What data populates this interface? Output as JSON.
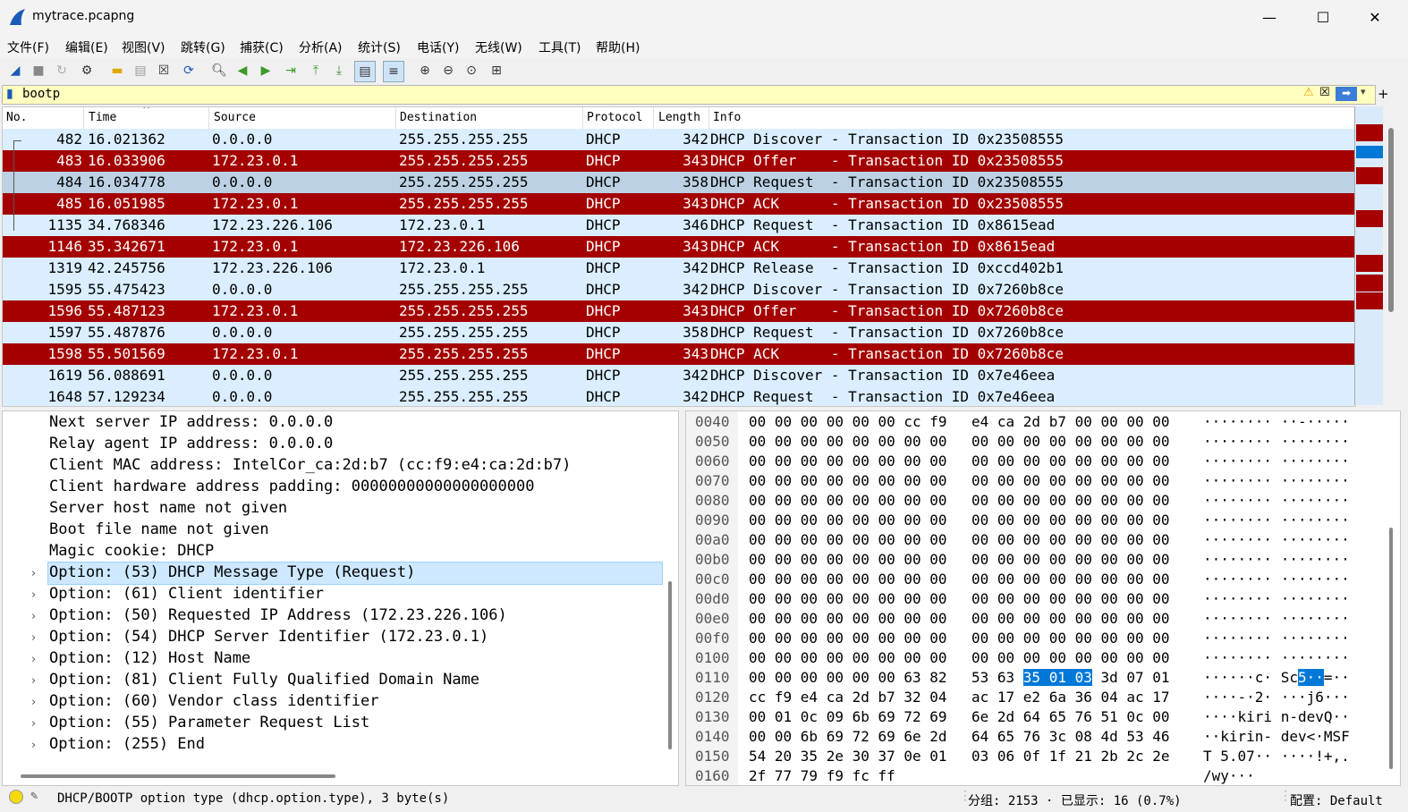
{
  "window": {
    "title": "mytrace.pcapng"
  },
  "menu": [
    "文件(F)",
    "编辑(E)",
    "视图(V)",
    "跳转(G)",
    "捕获(C)",
    "分析(A)",
    "统计(S)",
    "电话(Y)",
    "无线(W)",
    "工具(T)",
    "帮助(H)"
  ],
  "filter": {
    "value": "bootp"
  },
  "columns": [
    "No.",
    "Time",
    "Source",
    "Destination",
    "Protocol",
    "Length",
    "Info"
  ],
  "packets": [
    {
      "no": "482",
      "time": "16.021362",
      "src": "0.0.0.0",
      "dst": "255.255.255.255",
      "proto": "DHCP",
      "len": "342",
      "info": "DHCP Discover - Transaction ID 0x23508555",
      "style": "light"
    },
    {
      "no": "483",
      "time": "16.033906",
      "src": "172.23.0.1",
      "dst": "255.255.255.255",
      "proto": "DHCP",
      "len": "343",
      "info": "DHCP Offer    - Transaction ID 0x23508555",
      "style": "dark"
    },
    {
      "no": "484",
      "time": "16.034778",
      "src": "0.0.0.0",
      "dst": "255.255.255.255",
      "proto": "DHCP",
      "len": "358",
      "info": "DHCP Request  - Transaction ID 0x23508555",
      "style": "sel"
    },
    {
      "no": "485",
      "time": "16.051985",
      "src": "172.23.0.1",
      "dst": "255.255.255.255",
      "proto": "DHCP",
      "len": "343",
      "info": "DHCP ACK      - Transaction ID 0x23508555",
      "style": "dark"
    },
    {
      "no": "1135",
      "time": "34.768346",
      "src": "172.23.226.106",
      "dst": "172.23.0.1",
      "proto": "DHCP",
      "len": "346",
      "info": "DHCP Request  - Transaction ID 0x8615ead",
      "style": "light"
    },
    {
      "no": "1146",
      "time": "35.342671",
      "src": "172.23.0.1",
      "dst": "172.23.226.106",
      "proto": "DHCP",
      "len": "343",
      "info": "DHCP ACK      - Transaction ID 0x8615ead",
      "style": "dark"
    },
    {
      "no": "1319",
      "time": "42.245756",
      "src": "172.23.226.106",
      "dst": "172.23.0.1",
      "proto": "DHCP",
      "len": "342",
      "info": "DHCP Release  - Transaction ID 0xccd402b1",
      "style": "light"
    },
    {
      "no": "1595",
      "time": "55.475423",
      "src": "0.0.0.0",
      "dst": "255.255.255.255",
      "proto": "DHCP",
      "len": "342",
      "info": "DHCP Discover - Transaction ID 0x7260b8ce",
      "style": "light"
    },
    {
      "no": "1596",
      "time": "55.487123",
      "src": "172.23.0.1",
      "dst": "255.255.255.255",
      "proto": "DHCP",
      "len": "343",
      "info": "DHCP Offer    - Transaction ID 0x7260b8ce",
      "style": "dark"
    },
    {
      "no": "1597",
      "time": "55.487876",
      "src": "0.0.0.0",
      "dst": "255.255.255.255",
      "proto": "DHCP",
      "len": "358",
      "info": "DHCP Request  - Transaction ID 0x7260b8ce",
      "style": "light"
    },
    {
      "no": "1598",
      "time": "55.501569",
      "src": "172.23.0.1",
      "dst": "255.255.255.255",
      "proto": "DHCP",
      "len": "343",
      "info": "DHCP ACK      - Transaction ID 0x7260b8ce",
      "style": "dark"
    },
    {
      "no": "1619",
      "time": "56.088691",
      "src": "0.0.0.0",
      "dst": "255.255.255.255",
      "proto": "DHCP",
      "len": "342",
      "info": "DHCP Discover - Transaction ID 0x7e46eea",
      "style": "light"
    },
    {
      "no": "1648",
      "time": "57.129234",
      "src": "0.0.0.0",
      "dst": "255.255.255.255",
      "proto": "DHCP",
      "len": "342",
      "info": "DHCP Request  - Transaction ID 0x7e46eea",
      "style": "light"
    }
  ],
  "details": [
    {
      "text": "Next server IP address: 0.0.0.0",
      "expandable": false
    },
    {
      "text": "Relay agent IP address: 0.0.0.0",
      "expandable": false
    },
    {
      "text": "Client MAC address: IntelCor_ca:2d:b7 (cc:f9:e4:ca:2d:b7)",
      "expandable": false
    },
    {
      "text": "Client hardware address padding: 00000000000000000000",
      "expandable": false
    },
    {
      "text": "Server host name not given",
      "expandable": false
    },
    {
      "text": "Boot file name not given",
      "expandable": false
    },
    {
      "text": "Magic cookie: DHCP",
      "expandable": false
    },
    {
      "text": "Option: (53) DHCP Message Type (Request)",
      "expandable": true
    },
    {
      "text": "Option: (61) Client identifier",
      "expandable": true
    },
    {
      "text": "Option: (50) Requested IP Address (172.23.226.106)",
      "expandable": true
    },
    {
      "text": "Option: (54) DHCP Server Identifier (172.23.0.1)",
      "expandable": true
    },
    {
      "text": "Option: (12) Host Name",
      "expandable": true
    },
    {
      "text": "Option: (81) Client Fully Qualified Domain Name",
      "expandable": true
    },
    {
      "text": "Option: (60) Vendor class identifier",
      "expandable": true
    },
    {
      "text": "Option: (55) Parameter Request List",
      "expandable": true
    },
    {
      "text": "Option: (255) End",
      "expandable": true
    }
  ],
  "hex": [
    {
      "off": "0040",
      "a": "00 00 00 00 00 00 cc f9",
      "b": "e4 ca 2d b7 00 00 00 00",
      "ascii": "········ ··-·····"
    },
    {
      "off": "0050",
      "a": "00 00 00 00 00 00 00 00",
      "b": "00 00 00 00 00 00 00 00",
      "ascii": "········ ········"
    },
    {
      "off": "0060",
      "a": "00 00 00 00 00 00 00 00",
      "b": "00 00 00 00 00 00 00 00",
      "ascii": "········ ········"
    },
    {
      "off": "0070",
      "a": "00 00 00 00 00 00 00 00",
      "b": "00 00 00 00 00 00 00 00",
      "ascii": "········ ········"
    },
    {
      "off": "0080",
      "a": "00 00 00 00 00 00 00 00",
      "b": "00 00 00 00 00 00 00 00",
      "ascii": "········ ········"
    },
    {
      "off": "0090",
      "a": "00 00 00 00 00 00 00 00",
      "b": "00 00 00 00 00 00 00 00",
      "ascii": "········ ········"
    },
    {
      "off": "00a0",
      "a": "00 00 00 00 00 00 00 00",
      "b": "00 00 00 00 00 00 00 00",
      "ascii": "········ ········"
    },
    {
      "off": "00b0",
      "a": "00 00 00 00 00 00 00 00",
      "b": "00 00 00 00 00 00 00 00",
      "ascii": "········ ········"
    },
    {
      "off": "00c0",
      "a": "00 00 00 00 00 00 00 00",
      "b": "00 00 00 00 00 00 00 00",
      "ascii": "········ ········"
    },
    {
      "off": "00d0",
      "a": "00 00 00 00 00 00 00 00",
      "b": "00 00 00 00 00 00 00 00",
      "ascii": "········ ········"
    },
    {
      "off": "00e0",
      "a": "00 00 00 00 00 00 00 00",
      "b": "00 00 00 00 00 00 00 00",
      "ascii": "········ ········"
    },
    {
      "off": "00f0",
      "a": "00 00 00 00 00 00 00 00",
      "b": "00 00 00 00 00 00 00 00",
      "ascii": "········ ········"
    },
    {
      "off": "0100",
      "a": "00 00 00 00 00 00 00 00",
      "b": "00 00 00 00 00 00 00 00",
      "ascii": "········ ········"
    },
    {
      "off": "0110",
      "a": "00 00 00 00 00 00 63 82",
      "b": "53 63 35 01 03 3d 07 01",
      "ascii": "······c· Sc5··=··"
    },
    {
      "off": "0120",
      "a": "cc f9 e4 ca 2d b7 32 04",
      "b": "ac 17 e2 6a 36 04 ac 17",
      "ascii": "····-·2· ···j6···"
    },
    {
      "off": "0130",
      "a": "00 01 0c 09 6b 69 72 69",
      "b": "6e 2d 64 65 76 51 0c 00",
      "ascii": "····kiri n-devQ··"
    },
    {
      "off": "0140",
      "a": "00 00 6b 69 72 69 6e 2d",
      "b": "64 65 76 3c 08 4d 53 46",
      "ascii": "··kirin- dev<·MSF"
    },
    {
      "off": "0150",
      "a": "54 20 35 2e 30 37 0e 01",
      "b": "03 06 0f 1f 21 2b 2c 2e",
      "ascii": "T 5.07·· ····!+,."
    },
    {
      "off": "0160",
      "a": "2f 77 79 f9 fc ff",
      "b": "",
      "ascii": "/wy···"
    }
  ],
  "status": {
    "field": "DHCP/BOOTP option type (dhcp.option.type), 3 byte(s)",
    "packets": "分组: 2153 · 已显示: 16 (0.7%)",
    "profile": "配置: Default"
  }
}
